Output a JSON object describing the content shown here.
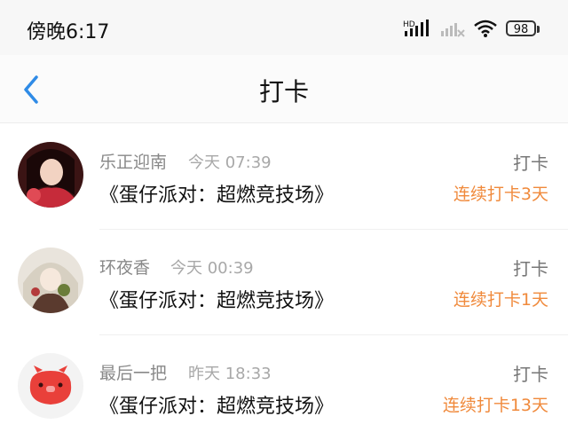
{
  "status_bar": {
    "time": "傍晚6:17",
    "network_label": "HD",
    "battery": "98"
  },
  "nav": {
    "title": "打卡"
  },
  "items": [
    {
      "user": "乐正迎南",
      "time": "今天 07:39",
      "game": "《蛋仔派对：超燃竞技场》",
      "type": "打卡",
      "streak": "连续打卡3天"
    },
    {
      "user": "环夜香",
      "time": "今天 00:39",
      "game": "《蛋仔派对：超燃竞技场》",
      "type": "打卡",
      "streak": "连续打卡1天"
    },
    {
      "user": "最后一把",
      "time": "昨天 18:33",
      "game": "《蛋仔派对：超燃竞技场》",
      "type": "打卡",
      "streak": "连续打卡13天"
    }
  ],
  "colors": {
    "accent_orange": "#f08a3c",
    "back_blue": "#2f8be6"
  }
}
